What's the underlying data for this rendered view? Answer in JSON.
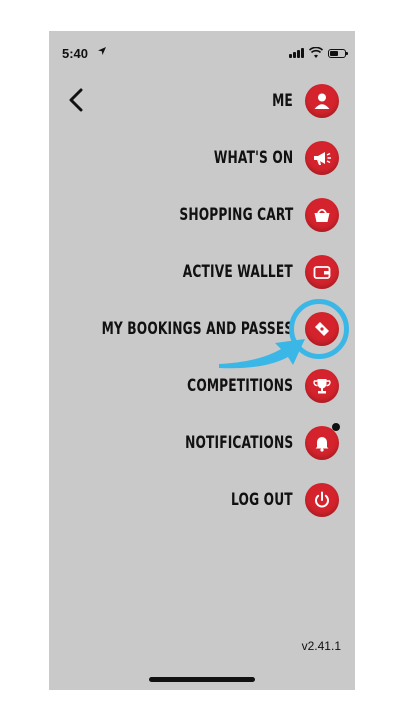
{
  "status_bar": {
    "time": "5:40"
  },
  "menu": {
    "items": [
      {
        "label": "ME",
        "icon": "person-icon"
      },
      {
        "label": "WHAT'S ON",
        "icon": "megaphone-icon"
      },
      {
        "label": "SHOPPING CART",
        "icon": "basket-icon"
      },
      {
        "label": "ACTIVE WALLET",
        "icon": "wallet-icon"
      },
      {
        "label": "MY BOOKINGS AND PASSES",
        "icon": "ticket-icon"
      },
      {
        "label": "COMPETITIONS",
        "icon": "trophy-icon"
      },
      {
        "label": "NOTIFICATIONS",
        "icon": "bell-icon"
      },
      {
        "label": "LOG OUT",
        "icon": "power-icon"
      }
    ]
  },
  "footer": {
    "version": "v2.41.1"
  },
  "colors": {
    "background": "#c9c9c9",
    "accent": "#d4232c",
    "highlight": "#3bb7e7"
  }
}
